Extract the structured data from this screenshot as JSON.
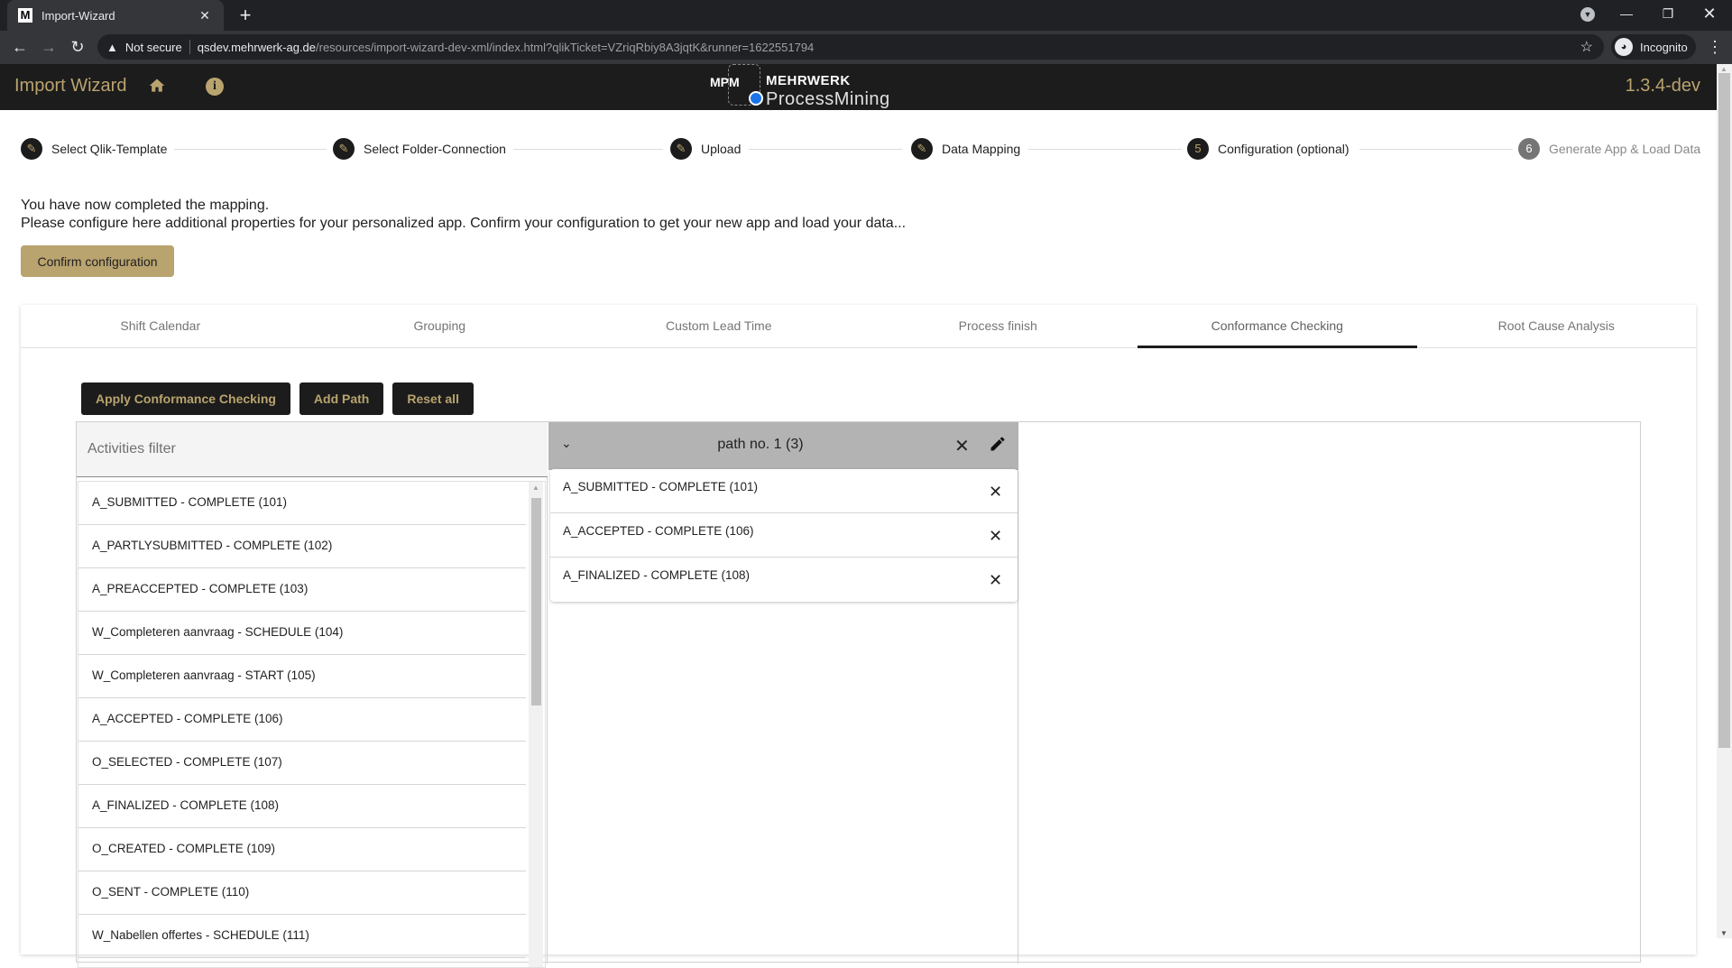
{
  "browser": {
    "tab_title": "Import-Wizard",
    "favicon_letter": "M",
    "security_label": "Not secure",
    "url_host": "qsdev.mehrwerk-ag.de",
    "url_path": "/resources/import-wizard-dev-xml/index.html?qlikTicket=VZriqRbiy8A3jqtK&runner=1622551794",
    "profile_label": "Incognito"
  },
  "header": {
    "title": "Import Wizard",
    "logo_mpm": "MPM",
    "logo_brand": "MEHRWERK",
    "logo_product": "ProcessMining",
    "version": "1.3.4-dev",
    "accent_color": "#b9a36e"
  },
  "stepper": {
    "steps": [
      {
        "label": "Select Qlik-Template",
        "state": "done",
        "icon": "pencil-icon"
      },
      {
        "label": "Select Folder-Connection",
        "state": "done",
        "icon": "pencil-icon"
      },
      {
        "label": "Upload",
        "state": "done",
        "icon": "pencil-icon"
      },
      {
        "label": "Data Mapping",
        "state": "done",
        "icon": "pencil-icon"
      },
      {
        "label": "Configuration (optional)",
        "state": "active",
        "number": "5"
      },
      {
        "label": "Generate App & Load Data",
        "state": "pending",
        "number": "6"
      }
    ]
  },
  "intro": {
    "line1": "You have now completed the mapping.",
    "line2": "Please configure here additional properties for your personalized app. Confirm your configuration to get your new app and load your data...",
    "confirm_label": "Confirm configuration"
  },
  "tabs": [
    {
      "label": "Shift Calendar",
      "active": false
    },
    {
      "label": "Grouping",
      "active": false
    },
    {
      "label": "Custom Lead Time",
      "active": false
    },
    {
      "label": "Process finish",
      "active": false
    },
    {
      "label": "Conformance Checking",
      "active": true
    },
    {
      "label": "Root Cause Analysis",
      "active": false
    }
  ],
  "actions": {
    "apply": "Apply Conformance Checking",
    "add_path": "Add Path",
    "reset": "Reset all"
  },
  "filter": {
    "placeholder": "Activities filter",
    "items": [
      "A_SUBMITTED - COMPLETE (101)",
      "A_PARTLYSUBMITTED - COMPLETE (102)",
      "A_PREACCEPTED - COMPLETE (103)",
      "W_Completeren aanvraag - SCHEDULE (104)",
      "W_Completeren aanvraag - START (105)",
      "A_ACCEPTED - COMPLETE (106)",
      "O_SELECTED - COMPLETE (107)",
      "A_FINALIZED - COMPLETE (108)",
      "O_CREATED - COMPLETE (109)",
      "O_SENT - COMPLETE (110)",
      "W_Nabellen offertes - SCHEDULE (111)"
    ]
  },
  "path": {
    "title": "path no. 1 (3)",
    "items": [
      "A_SUBMITTED - COMPLETE (101)",
      "A_ACCEPTED - COMPLETE (106)",
      "A_FINALIZED - COMPLETE (108)"
    ]
  }
}
